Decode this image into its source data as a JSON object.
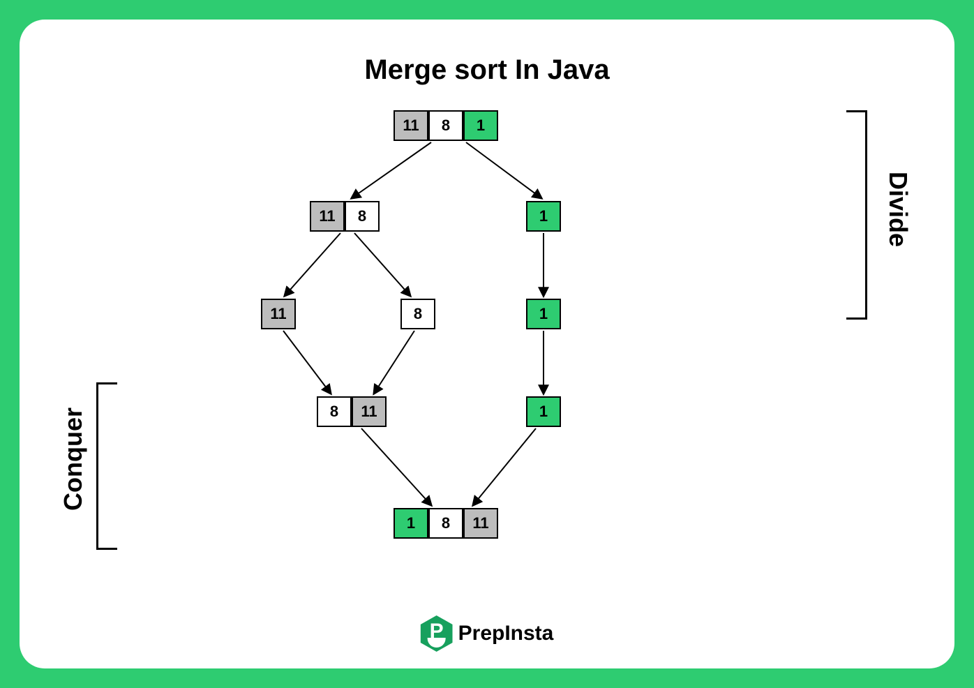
{
  "title": "Merge sort In Java",
  "labels": {
    "divide": "Divide",
    "conquer": "Conquer"
  },
  "logo": {
    "letter": "P",
    "name": "PrepInsta"
  },
  "nodes": {
    "root": [
      "11",
      "8",
      "1"
    ],
    "l1_left": [
      "11",
      "8"
    ],
    "l1_right": [
      "1"
    ],
    "l2_left_a": [
      "11"
    ],
    "l2_left_b": [
      "8"
    ],
    "l2_right": [
      "1"
    ],
    "l3_left": [
      "8",
      "11"
    ],
    "l3_right": [
      "1"
    ],
    "result": [
      "1",
      "8",
      "11"
    ]
  },
  "colors": {
    "root": [
      "gray",
      "white",
      "green"
    ],
    "l1_left": [
      "gray",
      "white"
    ],
    "l1_right": [
      "green"
    ],
    "l2_left_a": [
      "gray"
    ],
    "l2_left_b": [
      "white"
    ],
    "l2_right": [
      "green"
    ],
    "l3_left": [
      "white",
      "gray"
    ],
    "l3_right": [
      "green"
    ],
    "result": [
      "green",
      "white",
      "gray"
    ]
  }
}
